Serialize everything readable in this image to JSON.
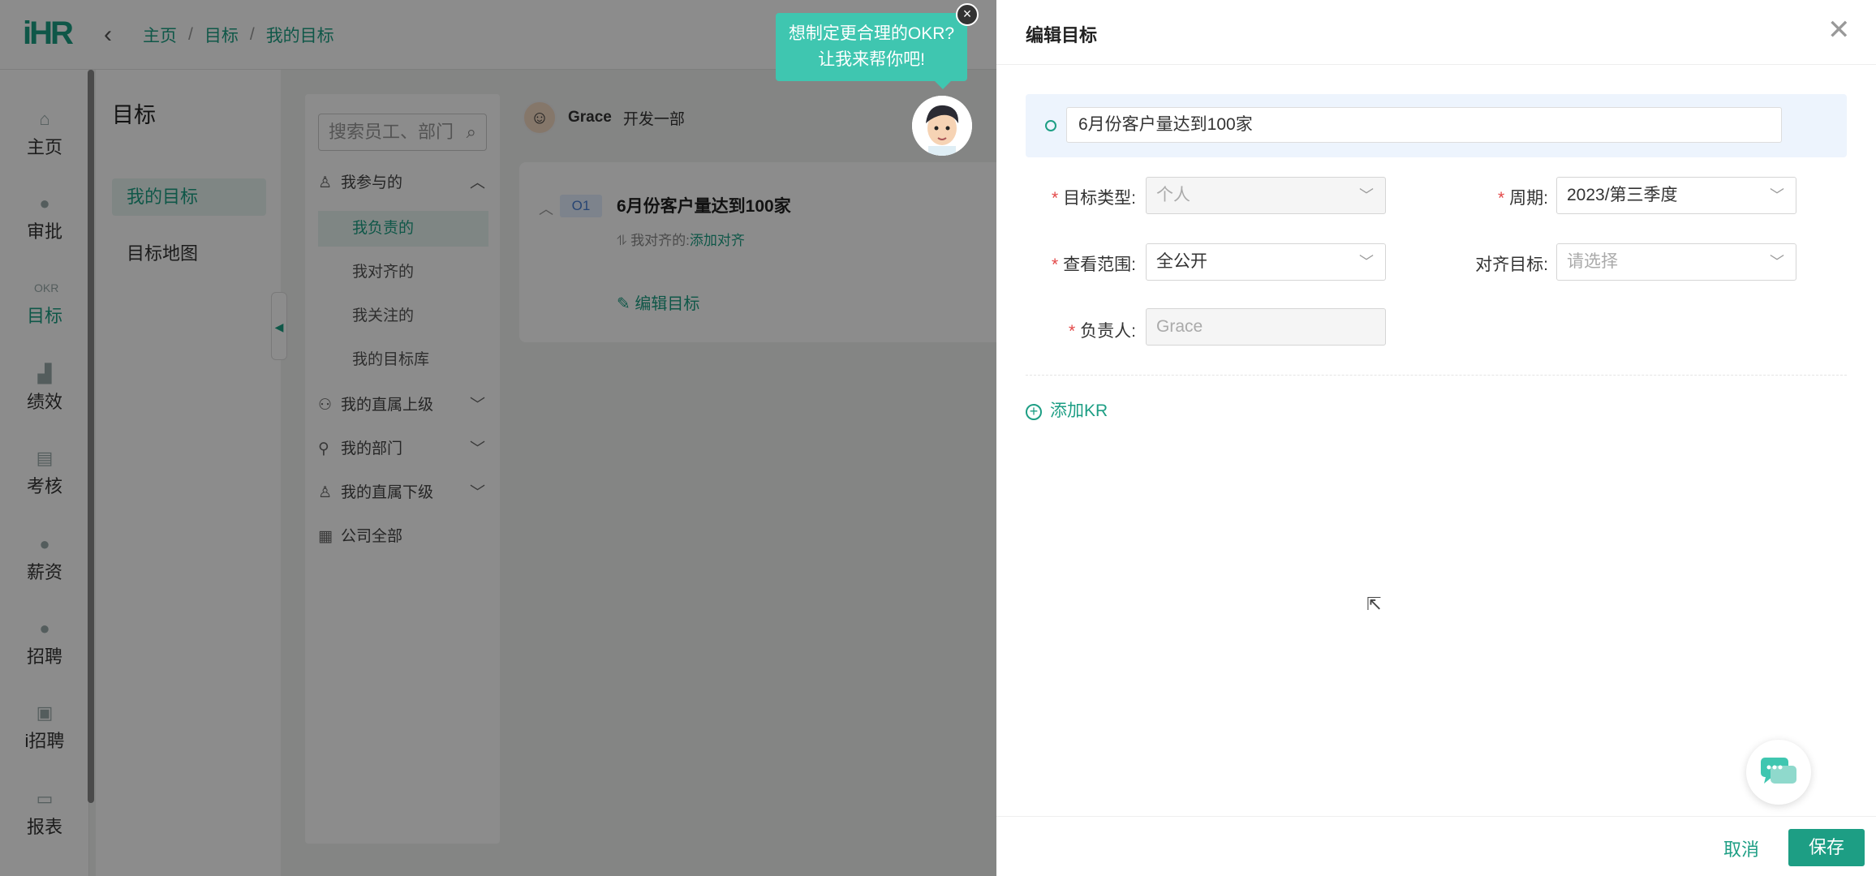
{
  "header": {
    "logo": "iHR",
    "breadcrumb": [
      "主页",
      "目标",
      "我的目标"
    ]
  },
  "sidenav": [
    {
      "label": "主页",
      "icon": "home-icon"
    },
    {
      "label": "审批",
      "icon": "approve-icon"
    },
    {
      "label": "目标",
      "icon": "okr-icon",
      "badge": "OKR",
      "active": true
    },
    {
      "label": "绩效",
      "icon": "chart-icon"
    },
    {
      "label": "考核",
      "icon": "assess-icon"
    },
    {
      "label": "薪资",
      "icon": "money-icon"
    },
    {
      "label": "招聘",
      "icon": "recruit-icon"
    },
    {
      "label": "i招聘",
      "icon": "irecruit-icon"
    },
    {
      "label": "报表",
      "icon": "report-icon"
    }
  ],
  "panel2": {
    "title": "目标",
    "items": [
      "我的目标",
      "目标地图"
    ]
  },
  "panel3": {
    "search_placeholder": "搜索员工、部门",
    "tree": [
      {
        "label": "我参与的",
        "icon": "person-icon",
        "chev": "up"
      },
      {
        "label": "我负责的",
        "sub": true,
        "selected": true
      },
      {
        "label": "我对齐的",
        "sub": true
      },
      {
        "label": "我关注的",
        "sub": true
      },
      {
        "label": "我的目标库",
        "sub": true
      },
      {
        "label": "我的直属上级",
        "icon": "group-icon",
        "chev": "down"
      },
      {
        "label": "我的部门",
        "icon": "dept-icon",
        "chev": "down"
      },
      {
        "label": "我的直属下级",
        "icon": "sub-icon",
        "chev": "down"
      },
      {
        "label": "公司全部",
        "icon": "grid-icon"
      }
    ]
  },
  "objective_card": {
    "user": "Grace",
    "dept": "开发一部",
    "badge": "O1",
    "title": "6月份客户量达到100家",
    "align_label": "我对齐的:",
    "align_link": "添加对齐",
    "edit": "编辑目标"
  },
  "bubble": {
    "line1": "想制定更合理的OKR?",
    "line2": "让我来帮你吧!"
  },
  "drawer": {
    "title": "编辑目标",
    "objective_value": "6月份客户量达到100家",
    "fields": {
      "type_label": "目标类型:",
      "type_value": "个人",
      "period_label": "周期:",
      "period_value": "2023/第三季度",
      "scope_label": "查看范围:",
      "scope_value": "全公开",
      "align_label": "对齐目标:",
      "align_placeholder": "请选择",
      "owner_label": "负责人:",
      "owner_value": "Grace"
    },
    "add_kr": "添加KR",
    "cancel": "取消",
    "save": "保存"
  },
  "colors": {
    "accent": "#1d9e84",
    "bubble": "#3fc6b0",
    "required": "#e34848"
  }
}
